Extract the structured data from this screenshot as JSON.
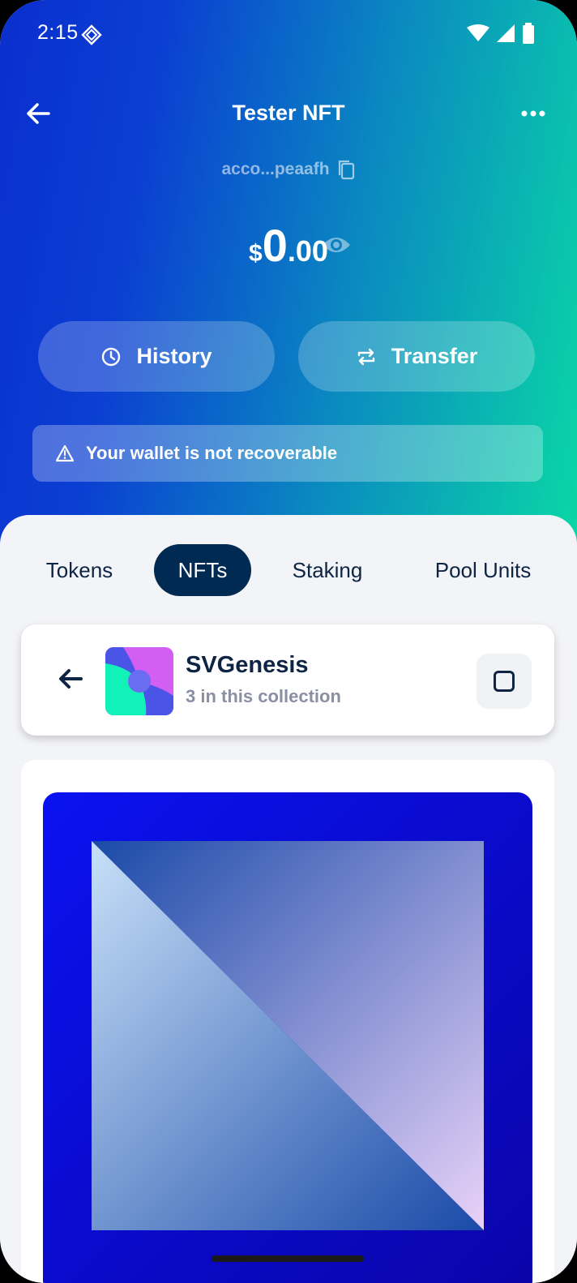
{
  "status": {
    "time": "2:15"
  },
  "header": {
    "title": "Tester NFT",
    "account": "acco...peaafh",
    "balance": {
      "currency": "$",
      "integer": "0",
      "decimal": ".00"
    }
  },
  "actions": {
    "history_label": "History",
    "transfer_label": "Transfer"
  },
  "warning": {
    "text": "Your wallet is not recoverable"
  },
  "tabs": [
    {
      "label": "Tokens"
    },
    {
      "label": "NFTs",
      "selected": true
    },
    {
      "label": "Staking"
    },
    {
      "label": "Pool Units"
    }
  ],
  "collection": {
    "name": "SVGenesis",
    "count_text": "3 in this collection"
  },
  "colors": {
    "gradient_start": "#0a2fcf",
    "gradient_end": "#0ad8a6",
    "tab_active_bg": "#002a52",
    "text_dark": "#0d2444"
  },
  "icons": [
    "back-arrow-icon",
    "more-icon",
    "copy-icon",
    "eye-icon",
    "clock-icon",
    "transfer-icon",
    "warning-icon",
    "checkbox-icon"
  ]
}
